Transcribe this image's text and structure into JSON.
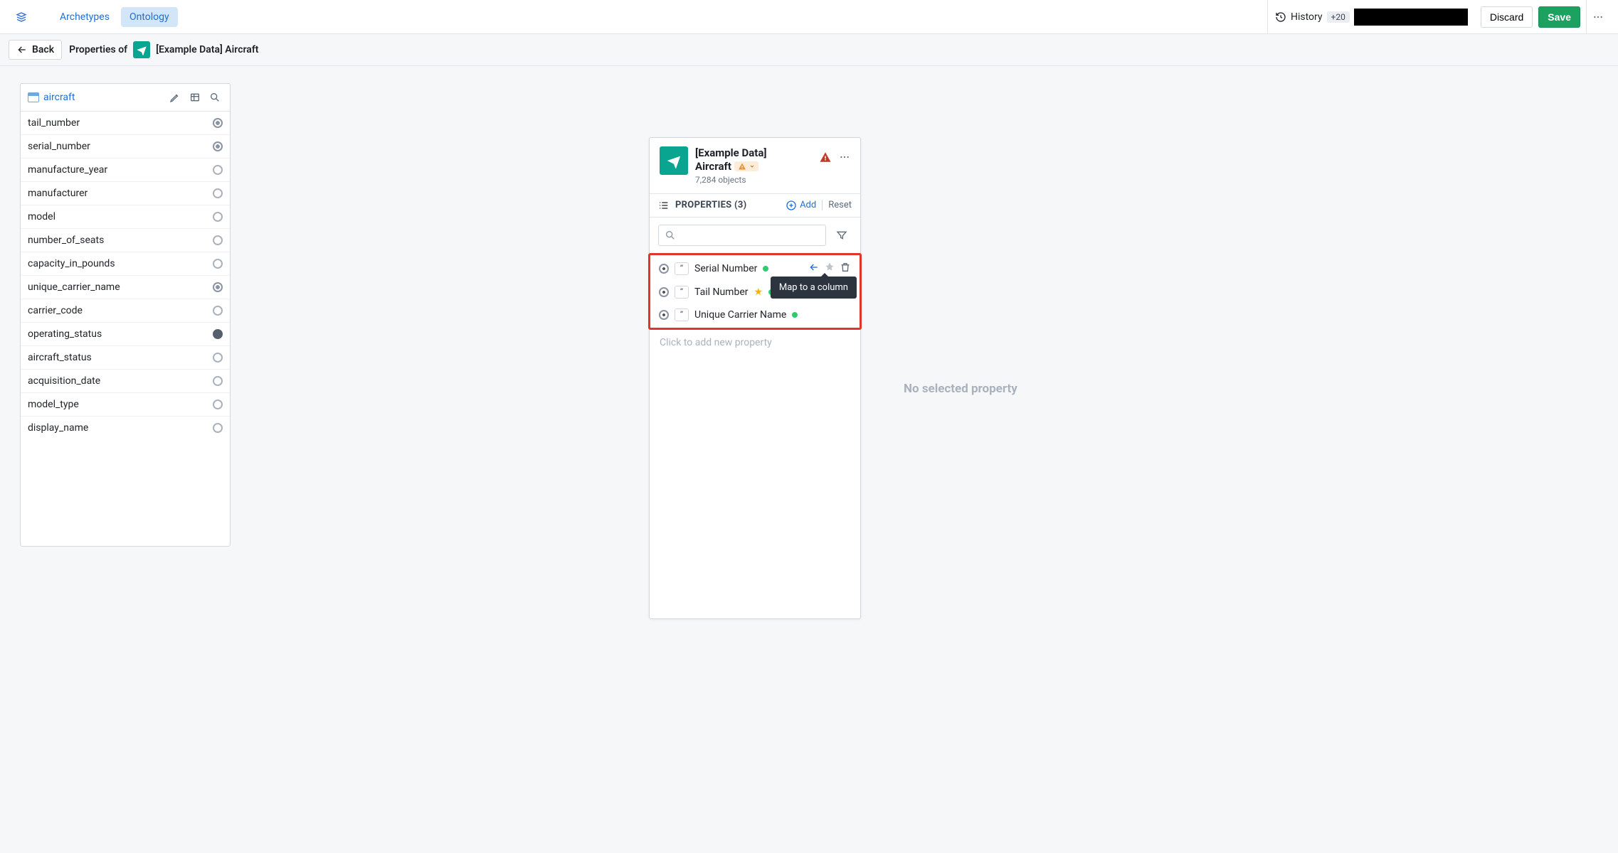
{
  "nav": {
    "archetypes": "Archetypes",
    "ontology": "Ontology"
  },
  "topbar": {
    "history_label": "History",
    "history_badge": "+20",
    "discard": "Discard",
    "save": "Save"
  },
  "subheader": {
    "back": "Back",
    "prefix": "Properties of",
    "title": "[Example Data] Aircraft"
  },
  "dataset": {
    "name": "aircraft"
  },
  "columns": [
    {
      "name": "tail_number",
      "state": "linked"
    },
    {
      "name": "serial_number",
      "state": "linked"
    },
    {
      "name": "manufacture_year",
      "state": "empty"
    },
    {
      "name": "manufacturer",
      "state": "empty"
    },
    {
      "name": "model",
      "state": "empty"
    },
    {
      "name": "number_of_seats",
      "state": "empty"
    },
    {
      "name": "capacity_in_pounds",
      "state": "empty"
    },
    {
      "name": "unique_carrier_name",
      "state": "linked"
    },
    {
      "name": "carrier_code",
      "state": "empty"
    },
    {
      "name": "operating_status",
      "state": "filled"
    },
    {
      "name": "aircraft_status",
      "state": "empty"
    },
    {
      "name": "acquisition_date",
      "state": "empty"
    },
    {
      "name": "model_type",
      "state": "empty"
    },
    {
      "name": "display_name",
      "state": "empty"
    }
  ],
  "object": {
    "title_line1": "[Example Data]",
    "title_line2": "Aircraft",
    "count_label": "7,284 objects"
  },
  "panel": {
    "properties_label": "PROPERTIES (3)",
    "add": "Add",
    "reset": "Reset",
    "add_placeholder": "Click to add new property"
  },
  "properties": [
    {
      "name": "Serial Number",
      "starred": false,
      "hovered": true
    },
    {
      "name": "Tail Number",
      "starred": true,
      "hovered": false
    },
    {
      "name": "Unique Carrier Name",
      "starred": false,
      "hovered": false
    }
  ],
  "tooltip": "Map to a column",
  "empty_label": "No selected property"
}
